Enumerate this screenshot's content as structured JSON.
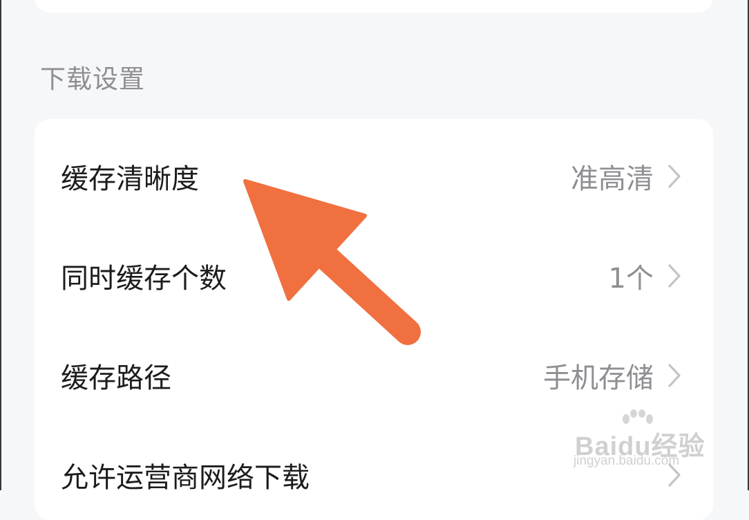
{
  "section": {
    "title": "下载设置"
  },
  "settings": [
    {
      "label": "缓存清晰度",
      "value": "准高清"
    },
    {
      "label": "同时缓存个数",
      "value": "1个"
    },
    {
      "label": "缓存路径",
      "value": "手机存储"
    },
    {
      "label": "允许运营商网络下载",
      "value": ""
    }
  ],
  "annotation": {
    "arrow_color": "#f07040"
  },
  "watermark": {
    "brand": "Baidu经验",
    "url": "jingyan.baidu.com"
  }
}
